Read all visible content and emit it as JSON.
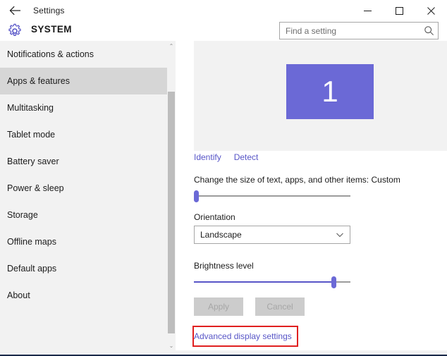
{
  "window": {
    "title": "Settings",
    "back_icon": "back-arrow-icon",
    "minimize_label": "─",
    "maximize_label": "☐",
    "close_label": "✕"
  },
  "header": {
    "gear_icon": "gear-icon",
    "title": "SYSTEM",
    "search": {
      "placeholder": "Find a setting",
      "value": "",
      "icon": "search-icon"
    }
  },
  "sidebar": {
    "items": [
      {
        "label": "Notifications & actions",
        "selected": false
      },
      {
        "label": "Apps & features",
        "selected": true
      },
      {
        "label": "Multitasking",
        "selected": false
      },
      {
        "label": "Tablet mode",
        "selected": false
      },
      {
        "label": "Battery saver",
        "selected": false
      },
      {
        "label": "Power & sleep",
        "selected": false
      },
      {
        "label": "Storage",
        "selected": false
      },
      {
        "label": "Offline maps",
        "selected": false
      },
      {
        "label": "Default apps",
        "selected": false
      },
      {
        "label": "About",
        "selected": false
      }
    ],
    "scrollbar": {
      "up_arrow": "⌃",
      "down_arrow": "⌄"
    }
  },
  "main": {
    "display_preview": {
      "monitor_number": "1",
      "monitor_color": "#6b69d6"
    },
    "identify_link": "Identify",
    "detect_link": "Detect",
    "size_label": "Change the size of text, apps, and other items: Custom",
    "size_slider": {
      "value_percent": 1
    },
    "orientation_label": "Orientation",
    "orientation_value": "Landscape",
    "orientation_chevron": "chevron-down-icon",
    "brightness_label": "Brightness level",
    "brightness_slider": {
      "value_percent": 89
    },
    "apply_button": "Apply",
    "cancel_button": "Cancel",
    "advanced_link": "Advanced display settings",
    "highlight_color": "#e02020"
  }
}
